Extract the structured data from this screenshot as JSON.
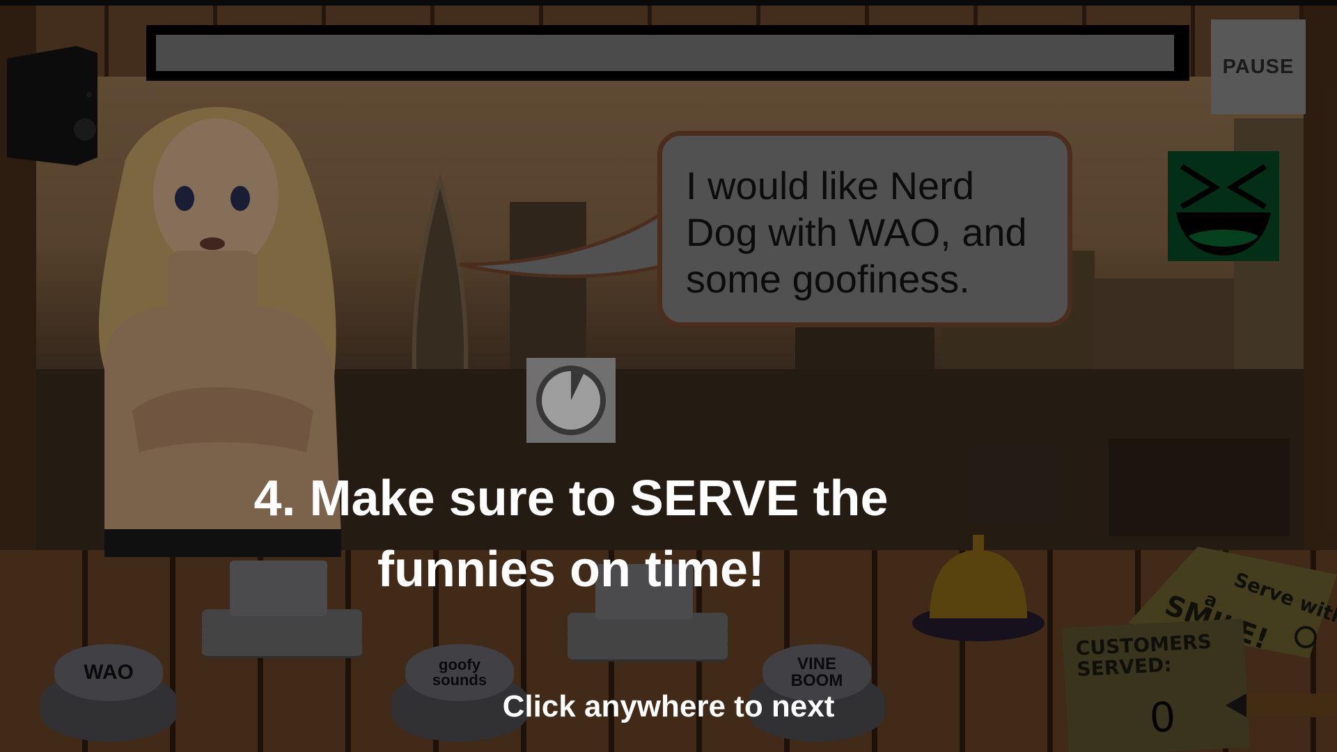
{
  "hud": {
    "pause_label": "PAUSE",
    "order_timer_fraction": 1.0
  },
  "customer": {
    "speech": "I would like Nerd Dog with WAO, and some goofiness.",
    "mood_icon": "laughing-face-icon",
    "mood_color": "#064c26"
  },
  "tutorial": {
    "step_text": "4. Make sure to SERVE the funnies on time!",
    "next_hint": "Click anywhere to next"
  },
  "sound_buttons": [
    {
      "label": "WAO"
    },
    {
      "label": "goofy sounds"
    },
    {
      "label": "VINE BOOM"
    }
  ],
  "sign": {
    "text_top": "Serve with",
    "text_mid": "a",
    "text_big": "SMILE!"
  },
  "tally": {
    "title_line1": "CUSTOMERS",
    "title_line2": "SERVED:",
    "count": "0"
  },
  "colors": {
    "bell": "#c99a20",
    "sign_paper": "#6f6433"
  }
}
